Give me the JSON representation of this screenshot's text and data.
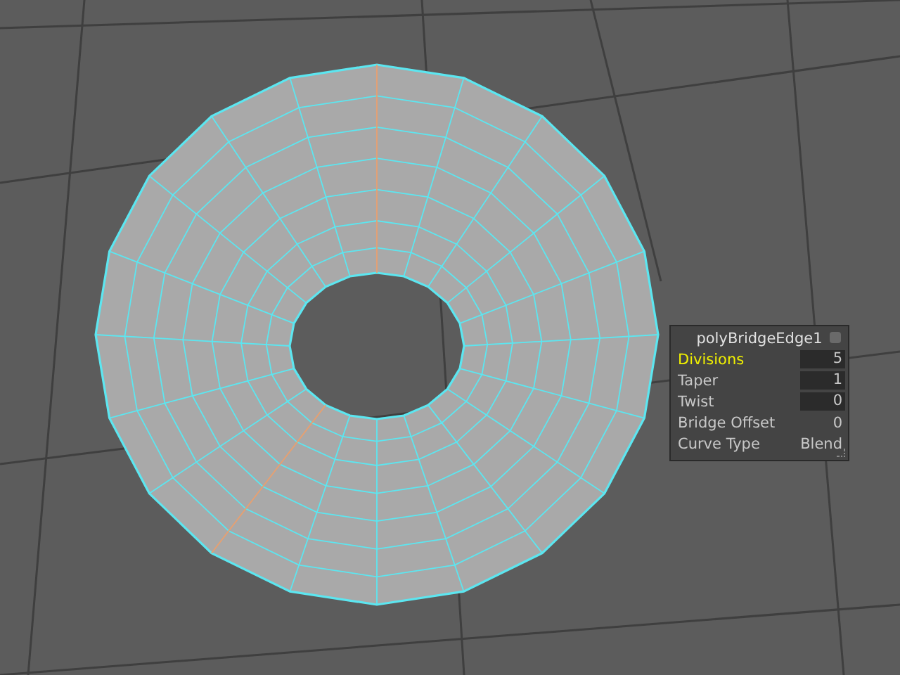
{
  "attribute_panel": {
    "title": "polyBridgeEdge1",
    "rows": [
      {
        "label": "Divisions",
        "value": "5",
        "kind": "field",
        "selected": true
      },
      {
        "label": "Taper",
        "value": "1",
        "kind": "field",
        "selected": false
      },
      {
        "label": "Twist",
        "value": "0",
        "kind": "field",
        "selected": false
      },
      {
        "label": "Bridge Offset",
        "value": "0",
        "kind": "plain",
        "selected": false
      },
      {
        "label": "Curve Type",
        "value": "Blend",
        "kind": "plain",
        "selected": false
      }
    ]
  }
}
